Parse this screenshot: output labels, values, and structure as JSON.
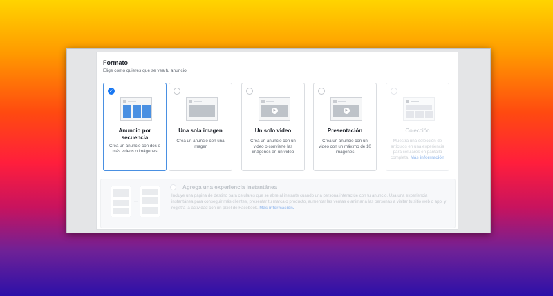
{
  "formato": {
    "title": "Formato",
    "subtitle": "Elige cómo quieres que se vea tu anuncio."
  },
  "cards": [
    {
      "title": "Anuncio por secuencia",
      "desc": "Crea un anuncio con dos o más videos o imágenes",
      "selected": true
    },
    {
      "title": "Una sola imagen",
      "desc": "Crea un anuncio con una imagen"
    },
    {
      "title": "Un solo video",
      "desc": "Crea un anuncio con un video o convierte las imágenes en un video"
    },
    {
      "title": "Presentación",
      "desc": "Crea un anuncio con un video con un máximo de 10 imágenes"
    },
    {
      "title": "Colección",
      "desc": "Muestra una colección de artículos en una experiencia para celulares en pantalla completa.",
      "link": "Más información",
      "disabled": true
    }
  ],
  "instant": {
    "title": "Agrega una experiencia instantánea",
    "desc": "Incluye una página de destino para celulares que se abre al instante cuando una persona interactúe con tu anuncio. Usa una experiencia instantánea para conseguir más clientes, presentar tu marca o producto, aumentar las ventas o animar a las personas a visitar tu sitio web o app, y registra la actividad con un píxel de Facebook.",
    "link": "Más información."
  },
  "colors": {
    "accent": "#1877f2",
    "selected_border": "#4a90e2"
  },
  "icons": {
    "check": "check-icon",
    "play": "play-icon"
  }
}
